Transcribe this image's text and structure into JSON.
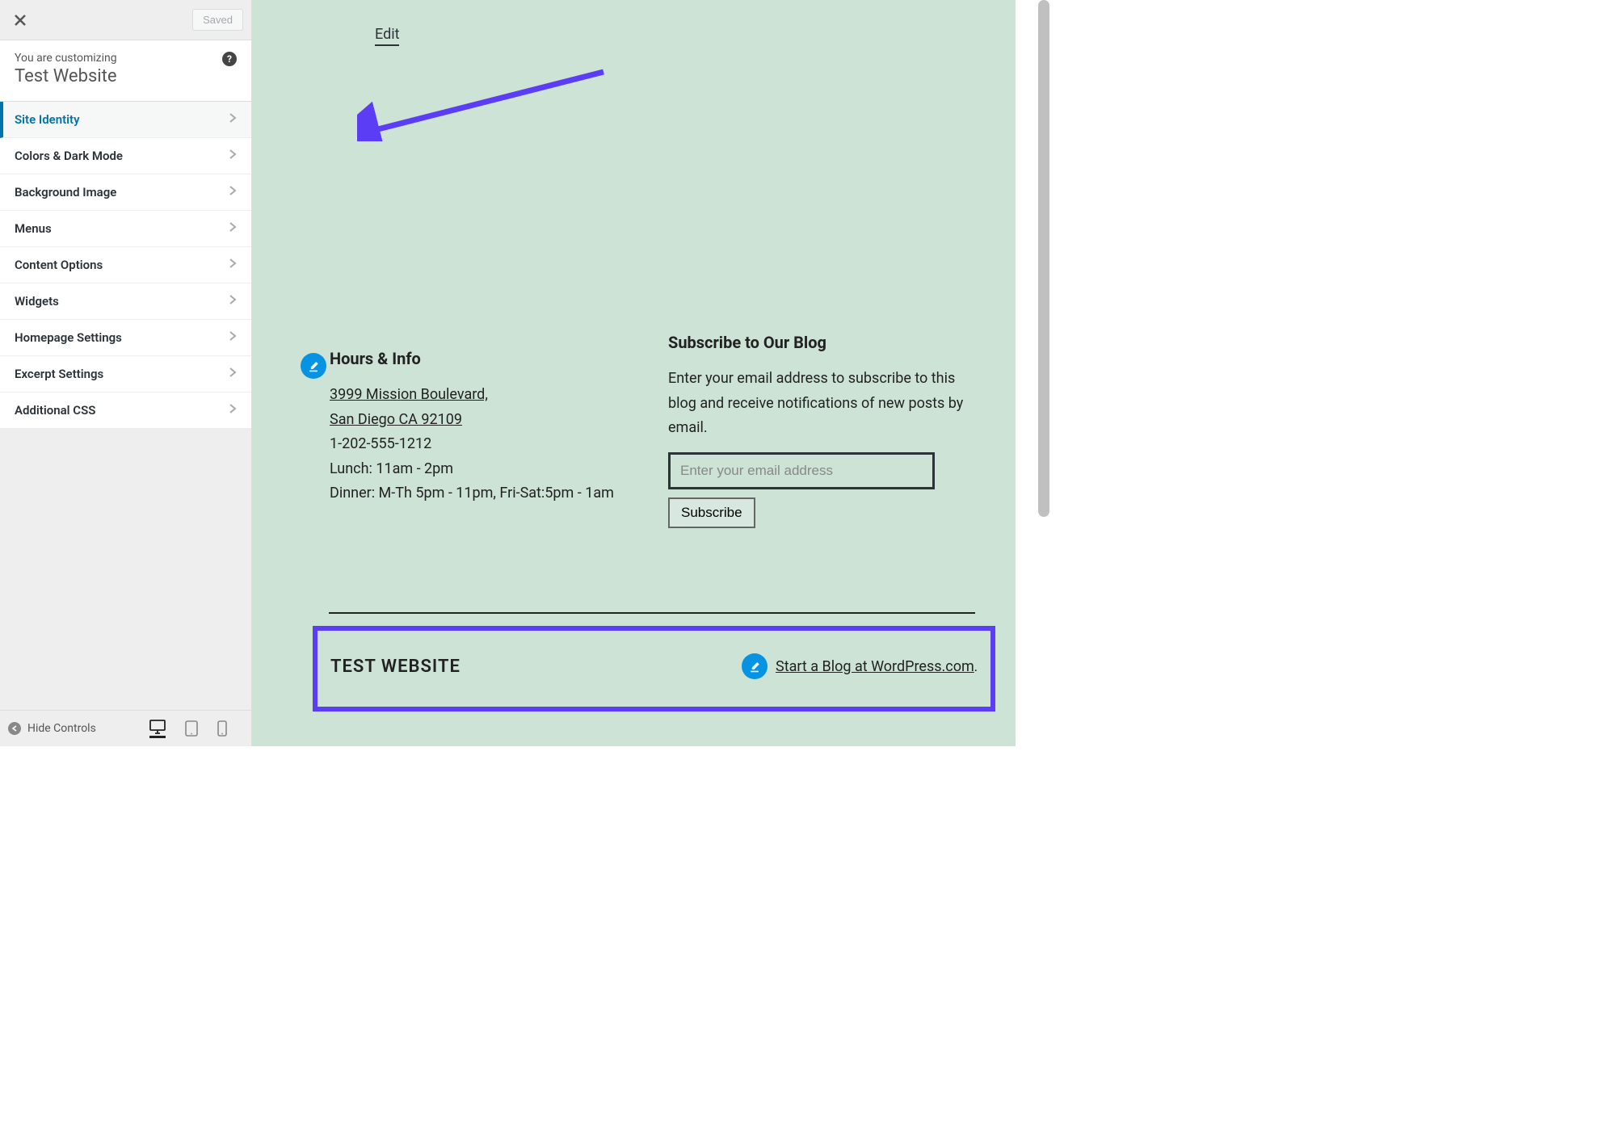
{
  "header": {
    "saved_label": "Saved",
    "customizing": "You are customizing",
    "site_name": "Test Website"
  },
  "sidebar": {
    "items": [
      {
        "label": "Site Identity",
        "active": true
      },
      {
        "label": "Colors & Dark Mode",
        "active": false
      },
      {
        "label": "Background Image",
        "active": false
      },
      {
        "label": "Menus",
        "active": false
      },
      {
        "label": "Content Options",
        "active": false
      },
      {
        "label": "Widgets",
        "active": false
      },
      {
        "label": "Homepage Settings",
        "active": false
      },
      {
        "label": "Excerpt Settings",
        "active": false
      },
      {
        "label": "Additional CSS",
        "active": false
      }
    ]
  },
  "footer_bar": {
    "hide_controls": "Hide Controls"
  },
  "preview": {
    "edit_link": "Edit",
    "hours": {
      "title": "Hours & Info",
      "address1": "3999 Mission Boulevard,",
      "address2": "San Diego CA 92109",
      "phone": "1-202-555-1212",
      "lunch": "Lunch: 11am - 2pm",
      "dinner": "Dinner: M-Th 5pm - 11pm, Fri-Sat:5pm - 1am"
    },
    "subscribe": {
      "title": "Subscribe to Our Blog",
      "desc": "Enter your email address to subscribe to this blog and receive notifications of new posts by email.",
      "placeholder": "Enter your email address",
      "button": "Subscribe"
    },
    "site_footer": {
      "title": "TEST WEBSITE",
      "wp_link": "Start a Blog at WordPress.com",
      "wp_link_suffix": "."
    }
  },
  "colors": {
    "accent": "#5b3df5",
    "wp_blue": "#0073aa",
    "badge_blue": "#0693e3",
    "preview_bg": "#cde3d6"
  }
}
